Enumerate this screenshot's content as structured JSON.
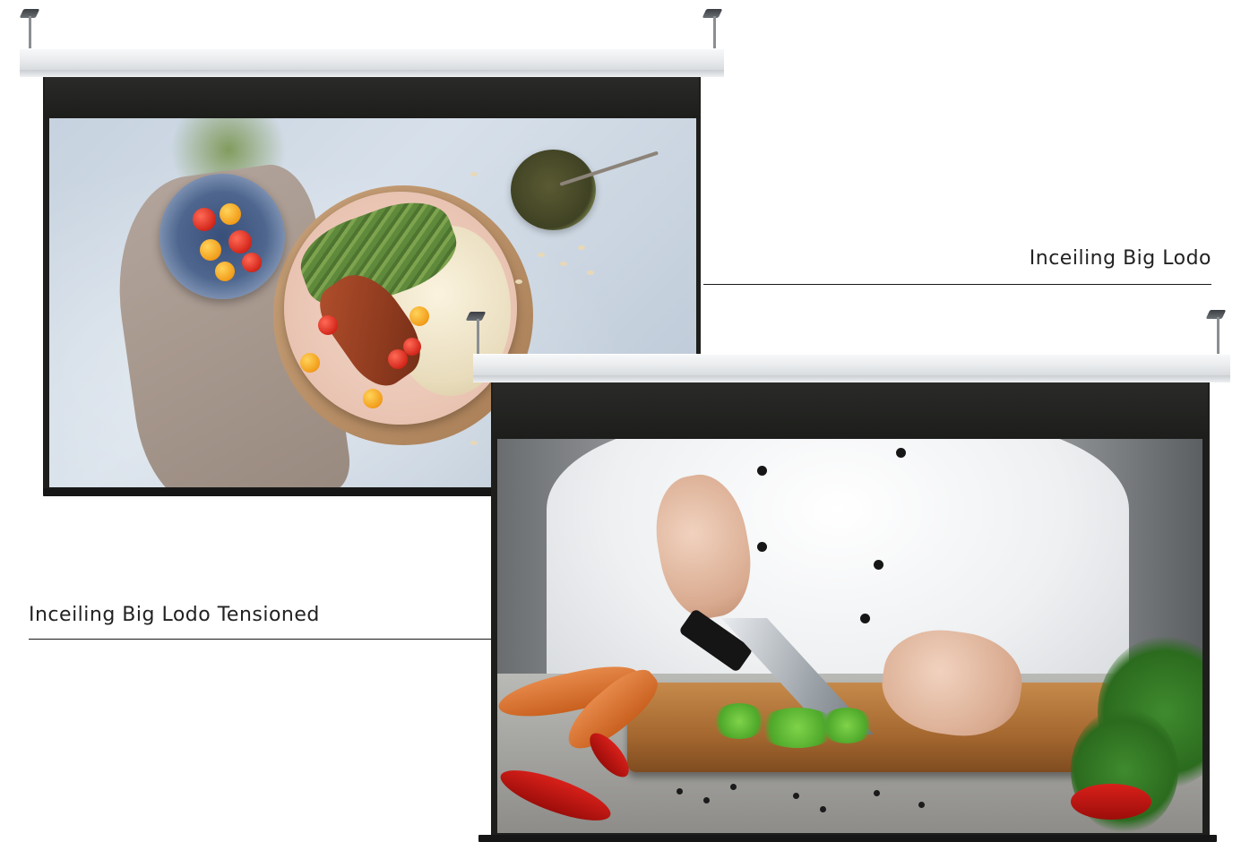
{
  "labels": {
    "top": "Inceiling Big Lodo",
    "bottom": "Inceiling Big Lodo Tensioned"
  },
  "colors": {
    "housing": "#eceef0",
    "case": "#1e1f1d",
    "label_text": "#222222",
    "background": "#ffffff"
  },
  "icons": {
    "hanger": "ceiling-hanger-icon"
  }
}
